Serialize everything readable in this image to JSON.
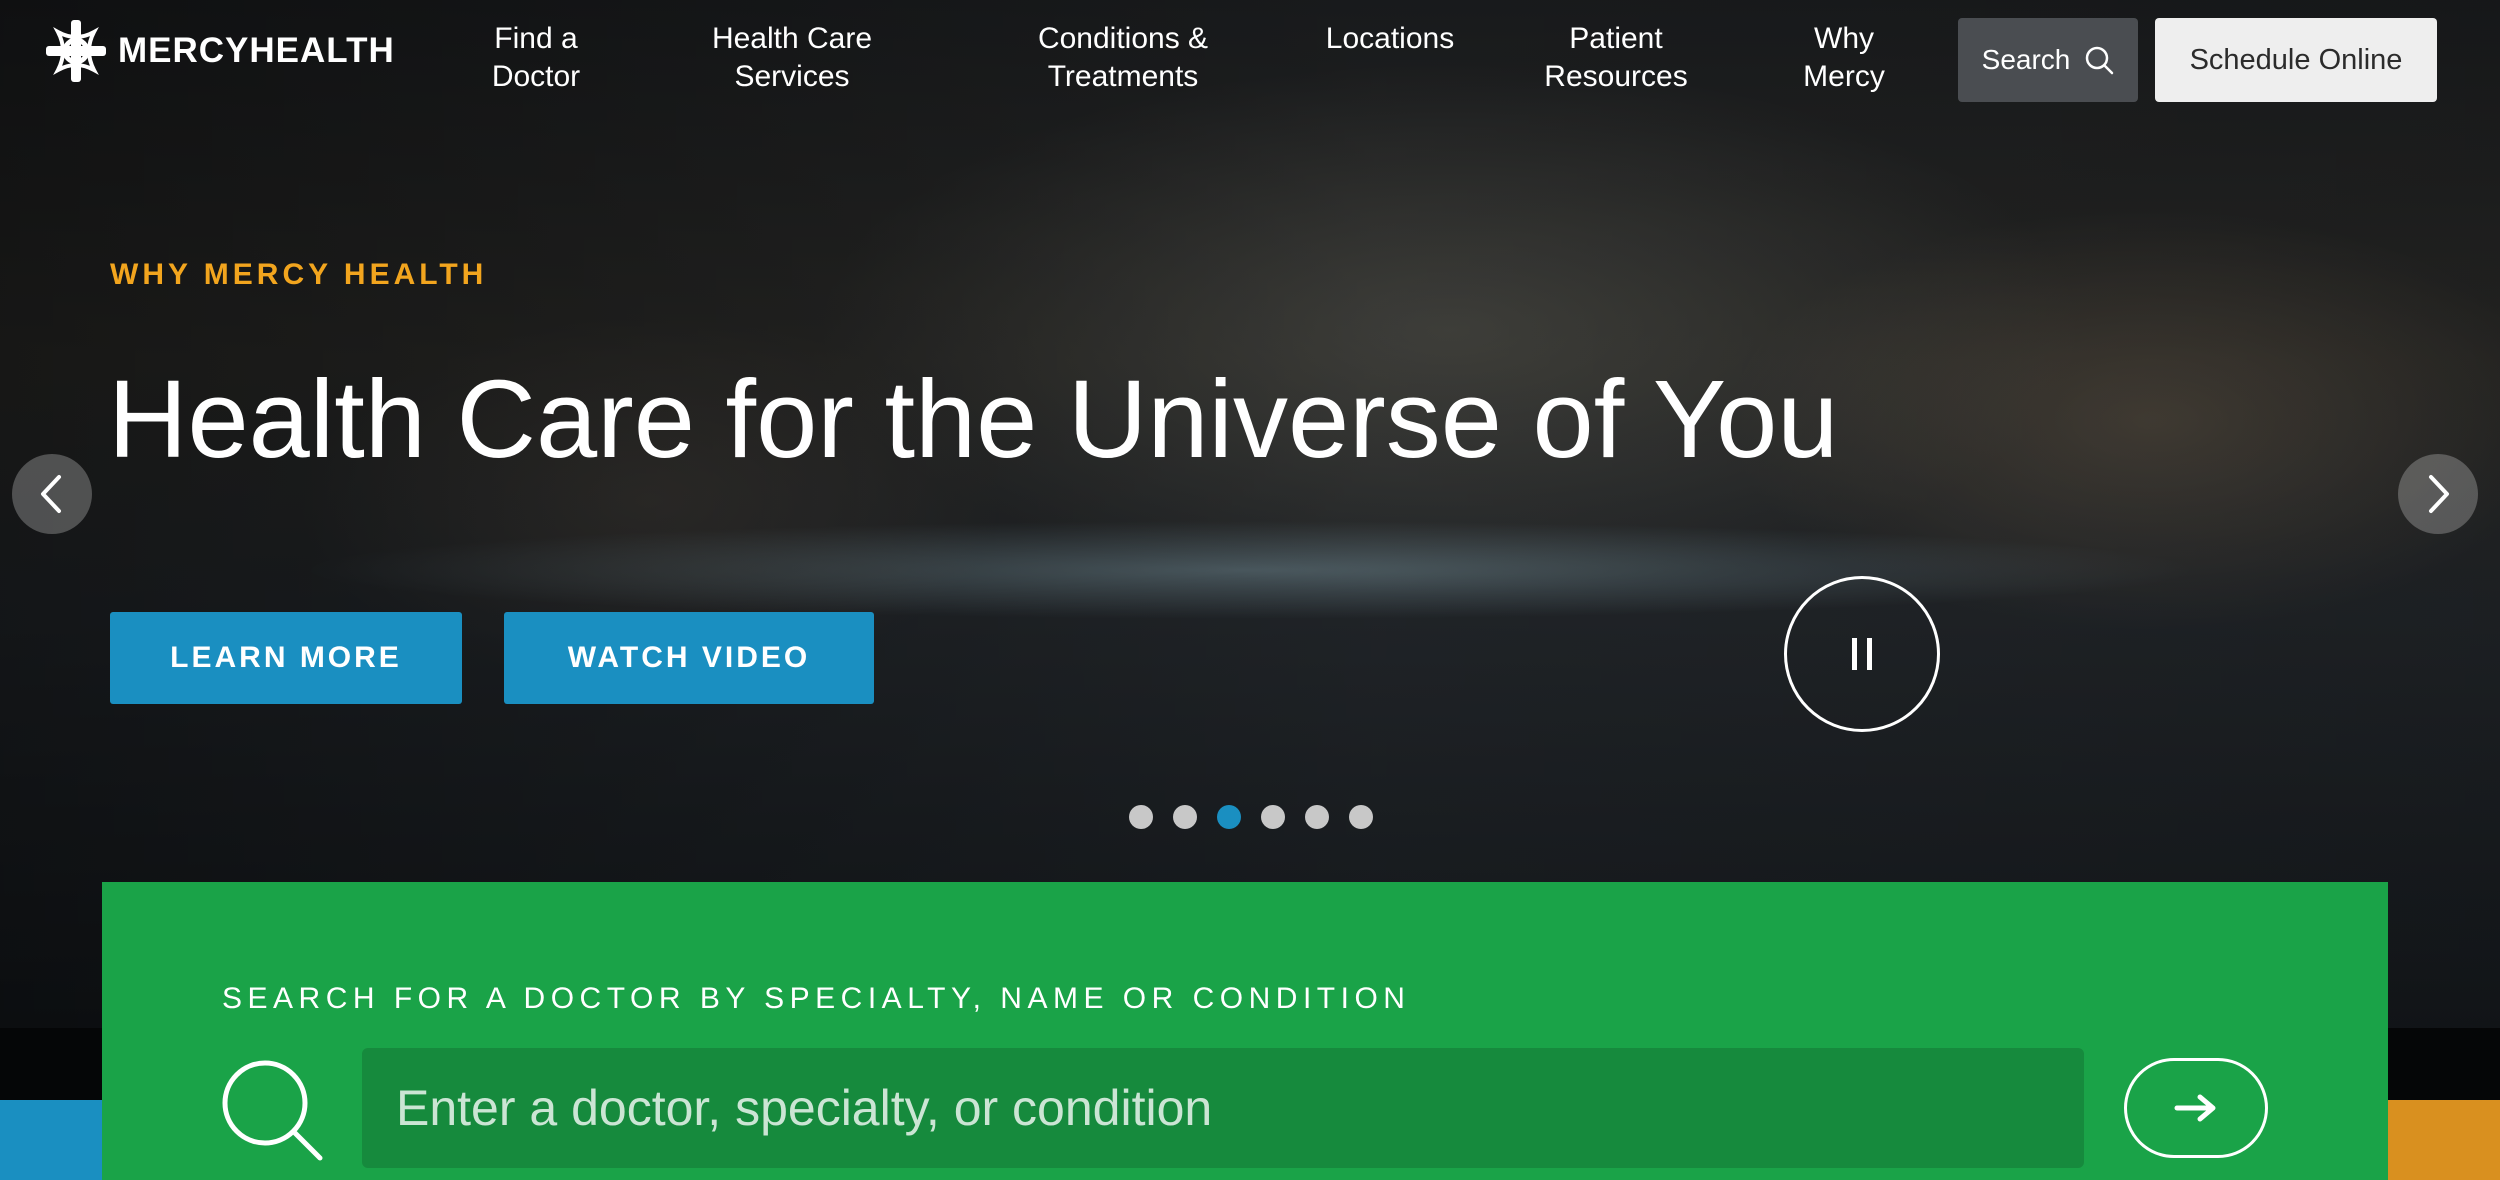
{
  "brand": {
    "name": "MERCYHEALTH"
  },
  "nav": [
    {
      "line1": "Find a",
      "line2": "Doctor"
    },
    {
      "line1": "Health Care",
      "line2": "Services"
    },
    {
      "line1": "Conditions &",
      "line2": "Treatments"
    },
    {
      "line1": "Locations",
      "line2": ""
    },
    {
      "line1": "Patient",
      "line2": "Resources"
    },
    {
      "line1": "Why",
      "line2": "Mercy"
    }
  ],
  "header": {
    "search_label": "Search",
    "schedule_label": "Schedule Online"
  },
  "hero": {
    "eyebrow": "WHY MERCY HEALTH",
    "headline": "Health Care for the Universe of You",
    "learn_more": "LEARN MORE",
    "watch_video": "WATCH VIDEO",
    "slide_count": 6,
    "active_slide": 3
  },
  "doctor_search": {
    "label": "SEARCH FOR A DOCTOR BY SPECIALTY, NAME OR CONDITION",
    "placeholder": "Enter a doctor, specialty, or condition"
  },
  "colors": {
    "accent_blue": "#1a8fc1",
    "eyebrow_orange": "#f2a51e",
    "panel_green": "#1aa348",
    "input_green": "#168a3d",
    "strip_orange": "#d9901f"
  },
  "icons": [
    "logo-cross-icon",
    "search-icon",
    "chevron-left-icon",
    "chevron-right-icon",
    "pause-icon",
    "magnifier-icon",
    "arrow-right-icon"
  ]
}
